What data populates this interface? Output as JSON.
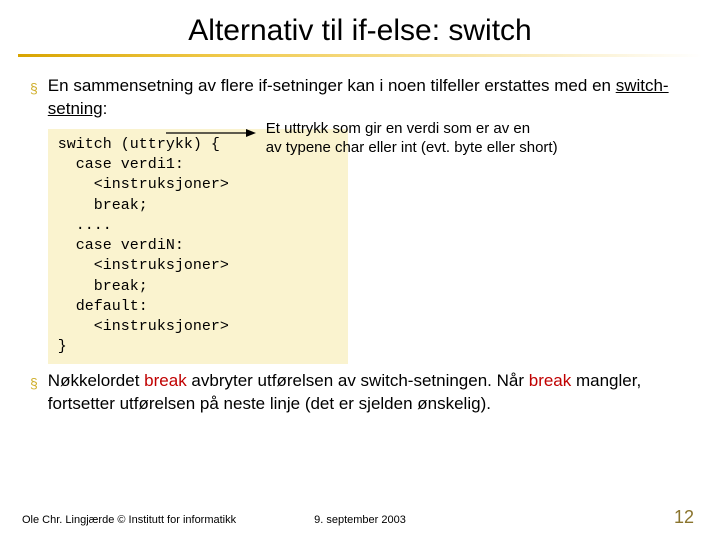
{
  "title": "Alternativ til if-else: switch",
  "bullets": [
    {
      "prefix": "En sammensetning av flere if-setninger kan i noen tilfeller erstattes med en ",
      "underlined": "switch-setning",
      "suffix": ":"
    },
    {
      "html": "Nøkkelordet <span class=\"red\">break</span> avbryter utførelsen av switch-setningen.  Når <span class=\"red\">break</span> mangler, fortsetter utførelsen på neste linje (det er sjelden ønskelig)."
    }
  ],
  "annotation": {
    "line1": "Et uttrykk som gir en verdi som er av en",
    "line2": "av typene char eller int (evt. byte eller short)"
  },
  "code": "switch (uttrykk) {\n  case verdi1:\n    <instruksjoner>\n    break;\n  ....\n  case verdiN:\n    <instruksjoner>\n    break;\n  default:\n    <instruksjoner>\n}",
  "footer": {
    "left": "Ole Chr. Lingjærde © Institutt for informatikk",
    "center": "9. september 2003",
    "right": "12"
  }
}
